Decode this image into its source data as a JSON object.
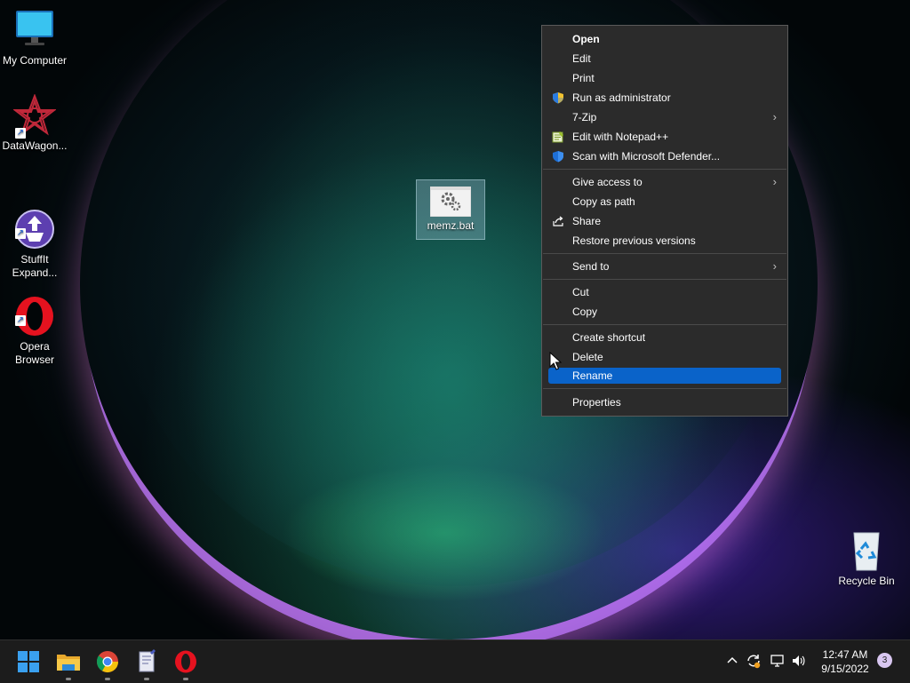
{
  "desktop": {
    "icons": [
      {
        "label": "My Computer"
      },
      {
        "label": "DataWagon..."
      },
      {
        "label": "StuffIt\nExpand..."
      },
      {
        "label": "Opera\nBrowser"
      },
      {
        "label": "Recycle Bin"
      }
    ],
    "selected_file": {
      "label": "memz.bat"
    }
  },
  "context_menu": {
    "items": [
      {
        "label": "Open"
      },
      {
        "label": "Edit"
      },
      {
        "label": "Print"
      },
      {
        "label": "Run as administrator",
        "icon": "uac-shield-icon"
      },
      {
        "label": "7-Zip"
      },
      {
        "label": "Edit with Notepad++",
        "icon": "notepad-plus-plus-icon"
      },
      {
        "label": "Scan with Microsoft Defender...",
        "icon": "defender-shield-icon"
      },
      {
        "label": "Give access to"
      },
      {
        "label": "Copy as path"
      },
      {
        "label": "Share",
        "icon": "share-icon"
      },
      {
        "label": "Restore previous versions"
      },
      {
        "label": "Send to"
      },
      {
        "label": "Cut"
      },
      {
        "label": "Copy"
      },
      {
        "label": "Create shortcut"
      },
      {
        "label": "Delete"
      },
      {
        "label": "Rename"
      },
      {
        "label": "Properties"
      }
    ],
    "submenu_arrow": "›",
    "highlight_color": "#0a63c9"
  },
  "taskbar": {
    "apps": [
      "windows-start-icon",
      "file-explorer-icon",
      "chrome-icon",
      "notepad-app-icon",
      "opera-icon"
    ],
    "tray": {
      "time": "12:47 AM",
      "date": "9/15/2022",
      "notification_count": "3"
    }
  }
}
